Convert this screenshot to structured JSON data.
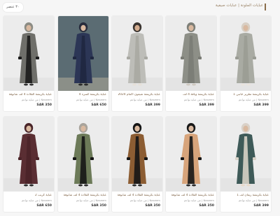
{
  "header": {
    "results_count": "٣٠ عنصر",
    "breadcrumb": "عبايات الملونة | عبايات صيفية"
  },
  "products": [
    {
      "name": "عباية بكريشة تطريز جانبي 1",
      "brand": "Naseem | من عباية نواعم",
      "price": "SAR 399",
      "old_price": "",
      "colors": {
        "bg": "#ececec",
        "robe": "#a9aba3",
        "trim": "#9a9c94",
        "hijab": "#d8cfc4",
        "skin": "#d9b9a0",
        "shoe": "#e9e3dc"
      }
    },
    {
      "name": "عباية بكريشة وياقة 4 لف",
      "brand": "Naseem | من عباية نواعم",
      "price": "SAR 399",
      "old_price": "",
      "colors": {
        "bg": "#ececec",
        "robe": "#8d8f87",
        "trim": "#7a7c75",
        "hijab": "#7d7f78",
        "skin": "#d9b9a0",
        "shoe": "#cfc9c0"
      }
    },
    {
      "name": "عباية بكريشة شيفون اكمام 2024",
      "brand": "Naseem | من عباية نواعم",
      "price": "SAR 399",
      "old_price": "",
      "colors": {
        "bg": "#ededed",
        "robe": "#bdbdb8",
        "trim": "#a8a8a2",
        "hijab": "#3a3430",
        "skin": "#d4ad90",
        "shoe": "#e6e0d8"
      }
    },
    {
      "name": "عباية بكريشة كسرة 4",
      "brand": "Naseem | من عباية نواعم",
      "price": "SAR 650",
      "old_price": "",
      "colors": {
        "bg": "#5b6c73",
        "robe": "#2c3656",
        "trim": "#1f2740",
        "hijab": "#272c3c",
        "skin": "#d9b9a0",
        "shoe": "#2a2a2a"
      }
    },
    {
      "name": "عباية بكريشة القلادة 4 لف شانوفة",
      "brand": "Naseem | من عباية نواعم",
      "price": "SAR 350",
      "old_price": "",
      "colors": {
        "bg": "#ececec",
        "robe": "#6f6f6a",
        "trim": "#1b1b1b",
        "hijab": "#8c8c84",
        "skin": "#d9b9a0",
        "shoe": "#303030"
      }
    },
    {
      "name": "عباية بكريشة ريفان لف 1",
      "brand": "Naseem | من عباية نواعم",
      "price": "SAR 399",
      "old_price": "",
      "colors": {
        "bg": "#ececec",
        "robe": "#3e5a58",
        "trim": "#d7d1c6",
        "hijab": "#d9d1c8",
        "skin": "#d9b9a0",
        "shoe": "#e7d9c9"
      }
    },
    {
      "name": "عباية بكريشة القلادة 4 لف شانوفة",
      "brand": "Naseem | من عباية نواعم",
      "price": "SAR 350",
      "old_price": "",
      "colors": {
        "bg": "#ececec",
        "robe": "#d7a47b",
        "trim": "#161616",
        "hijab": "#181818",
        "skin": "#d9b9a0",
        "shoe": "#2a2a2a"
      }
    },
    {
      "name": "عباية بكريشة القلادة 4 لف شانوفة",
      "brand": "Naseem | من عباية نواعم",
      "price": "SAR 350",
      "old_price": "",
      "colors": {
        "bg": "#ececec",
        "robe": "#8c5d33",
        "trim": "#151515",
        "hijab": "#151515",
        "skin": "#d9b9a0",
        "shoe": "#2a2a2a"
      }
    },
    {
      "name": "عباية بكريشة القلادة 4 لف شانوفة",
      "brand": "Naseem | من عباية نواعم",
      "price": "SAR 350",
      "old_price": "",
      "colors": {
        "bg": "#ececec",
        "robe": "#6c7a58",
        "trim": "#161616",
        "hijab": "#a9a49c",
        "skin": "#d9b9a0",
        "shoe": "#2a2a2a"
      }
    },
    {
      "name": "عباية كريب 2",
      "brand": "Naseem | من عباية نواعم",
      "price": "SAR 650",
      "old_price": "",
      "colors": {
        "bg": "#ececec",
        "robe": "#5a2e33",
        "trim": "#4a2328",
        "hijab": "#4a2529",
        "skin": "#d9b9a0",
        "shoe": "#2a2a2a"
      }
    }
  ]
}
